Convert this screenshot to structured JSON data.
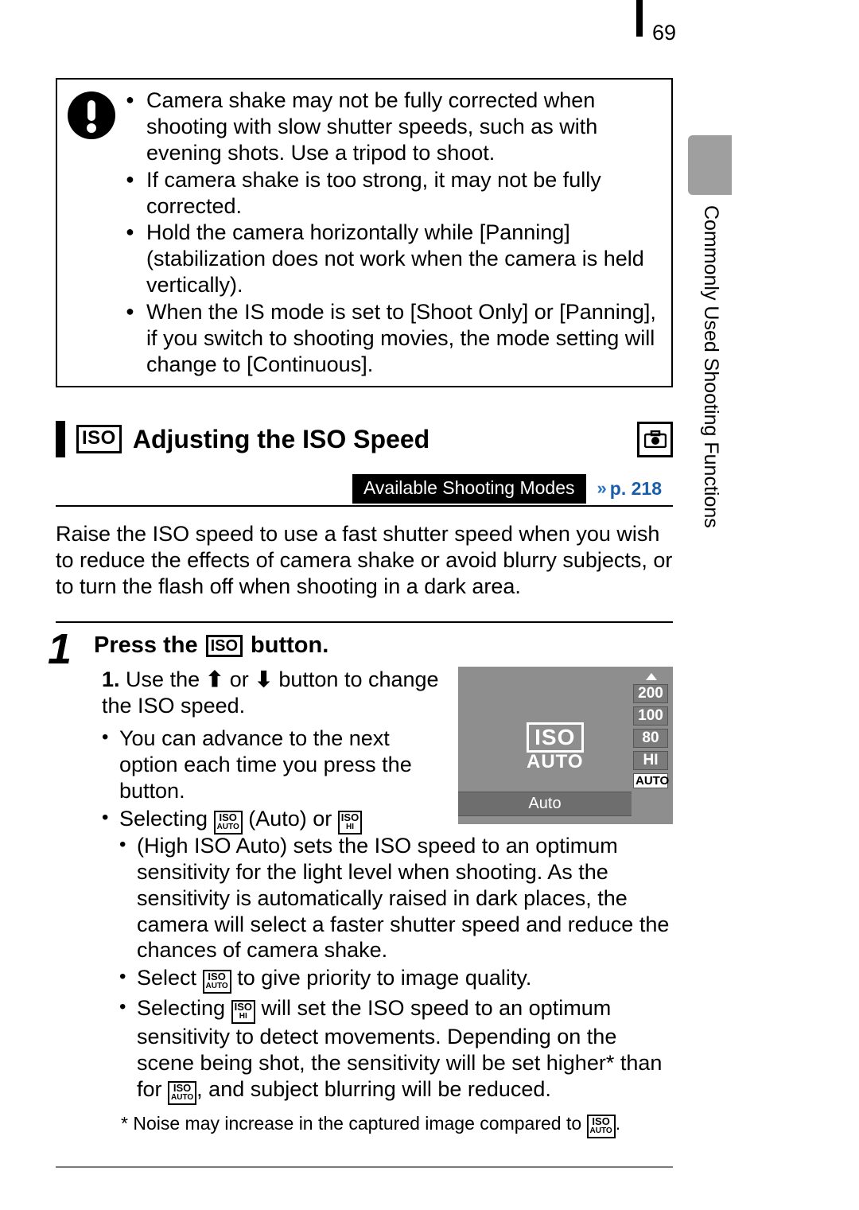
{
  "page_number": "69",
  "side_tab_label": "Commonly Used Shooting Functions",
  "caution": {
    "icon_name": "caution-icon",
    "bullets": [
      "Camera shake may not be fully corrected when shooting with slow shutter speeds, such as with evening shots. Use a tripod to shoot.",
      "If camera shake is too strong, it may not be fully corrected.",
      "Hold the camera horizontally while [Panning] (stabilization does not work when the camera is held vertically).",
      "When the IS mode is set to [Shoot Only] or [Panning], if you switch to shooting movies, the mode setting will change to [Continuous]."
    ]
  },
  "section": {
    "iso_chip": "ISO",
    "title": "Adjusting the ISO Speed",
    "camera_icon": "camera-icon",
    "modes_badge": "Available Shooting Modes",
    "modes_page_ref": "p. 218"
  },
  "intro": "Raise the ISO speed to use a fast shutter speed when you wish to reduce the effects of camera shake or avoid blurry subjects, or to turn the flash off when shooting in a dark area.",
  "step": {
    "number": "1",
    "title_pre": "Press the",
    "title_chip": "ISO",
    "title_post": "button.",
    "sub1_num": "1.",
    "sub1_pre": "Use the ",
    "sub1_mid": " or ",
    "sub1_post": " button to change the ISO speed.",
    "sub_b1": "You can advance to the next option each time you press the button.",
    "sub_b2_pre": "Selecting ",
    "sub_b2_mid1": " (Auto) or ",
    "sub_b2_mid2": " (High ISO Auto) sets the ISO speed to an optimum sensitivity for the light level when shooting. As the sensitivity is automatically raised in dark places, the camera will select a faster shutter speed and reduce the chances of camera shake.",
    "sub_b3_pre": "Select ",
    "sub_b3_post": " to give priority to image quality.",
    "sub_b4_pre": "Selecting ",
    "sub_b4_mid": " will set the ISO speed to an optimum sensitivity to detect movements. Depending on the scene being shot, the sensitivity will be set higher* than for ",
    "sub_b4_post": ", and subject blurring will be reduced.",
    "footnote_pre": "* Noise may increase in the captured image compared to ",
    "footnote_post": "."
  },
  "screen": {
    "center_iso": "ISO",
    "center_auto": "AUTO",
    "mode_line": "Auto",
    "options": [
      "200",
      "100",
      "80",
      "HI",
      "AUTO"
    ],
    "selected_index": 4
  }
}
